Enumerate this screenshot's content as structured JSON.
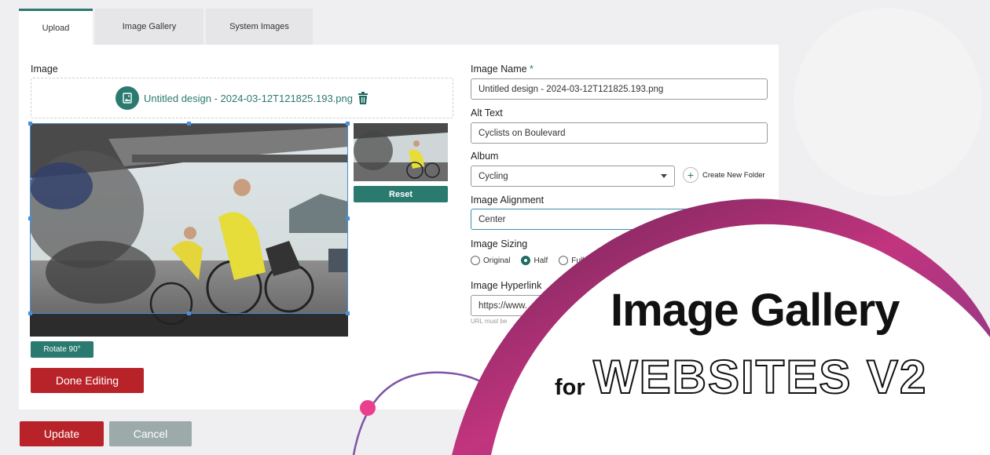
{
  "tabs": [
    {
      "label": "Upload",
      "active": true
    },
    {
      "label": "Image Gallery",
      "active": false
    },
    {
      "label": "System Images",
      "active": false
    }
  ],
  "image_section": {
    "label": "Image",
    "filename": "Untitled design - 2024-03-12T121825.193.png",
    "reset_label": "Reset",
    "rotate_label": "Rotate 90°",
    "done_label": "Done Editing"
  },
  "form": {
    "image_name_label": "Image Name",
    "required_mark": "*",
    "image_name_value": "Untitled design - 2024-03-12T121825.193.png",
    "alt_text_label": "Alt Text",
    "alt_text_value": "Cyclists on Boulevard",
    "album_label": "Album",
    "album_value": "Cycling",
    "create_folder_label": "Create New Folder",
    "alignment_label": "Image Alignment",
    "alignment_value": "Center",
    "sizing_label": "Image Sizing",
    "sizing_options": [
      "Original",
      "Half",
      "Full"
    ],
    "sizing_selected": "Half",
    "hyperlink_label": "Image Hyperlink",
    "hyperlink_value": "https://www.",
    "hyperlink_hint": "URL must be"
  },
  "actions": {
    "update_label": "Update",
    "cancel_label": "Cancel"
  },
  "promo": {
    "title": "Image Gallery",
    "for": "for",
    "subtitle": "WEBSITES V2"
  },
  "colors": {
    "accent": "#2a7a70",
    "danger": "#b8232a",
    "promo_gradient_start": "#c2347e",
    "promo_gradient_end": "#6b2456"
  }
}
